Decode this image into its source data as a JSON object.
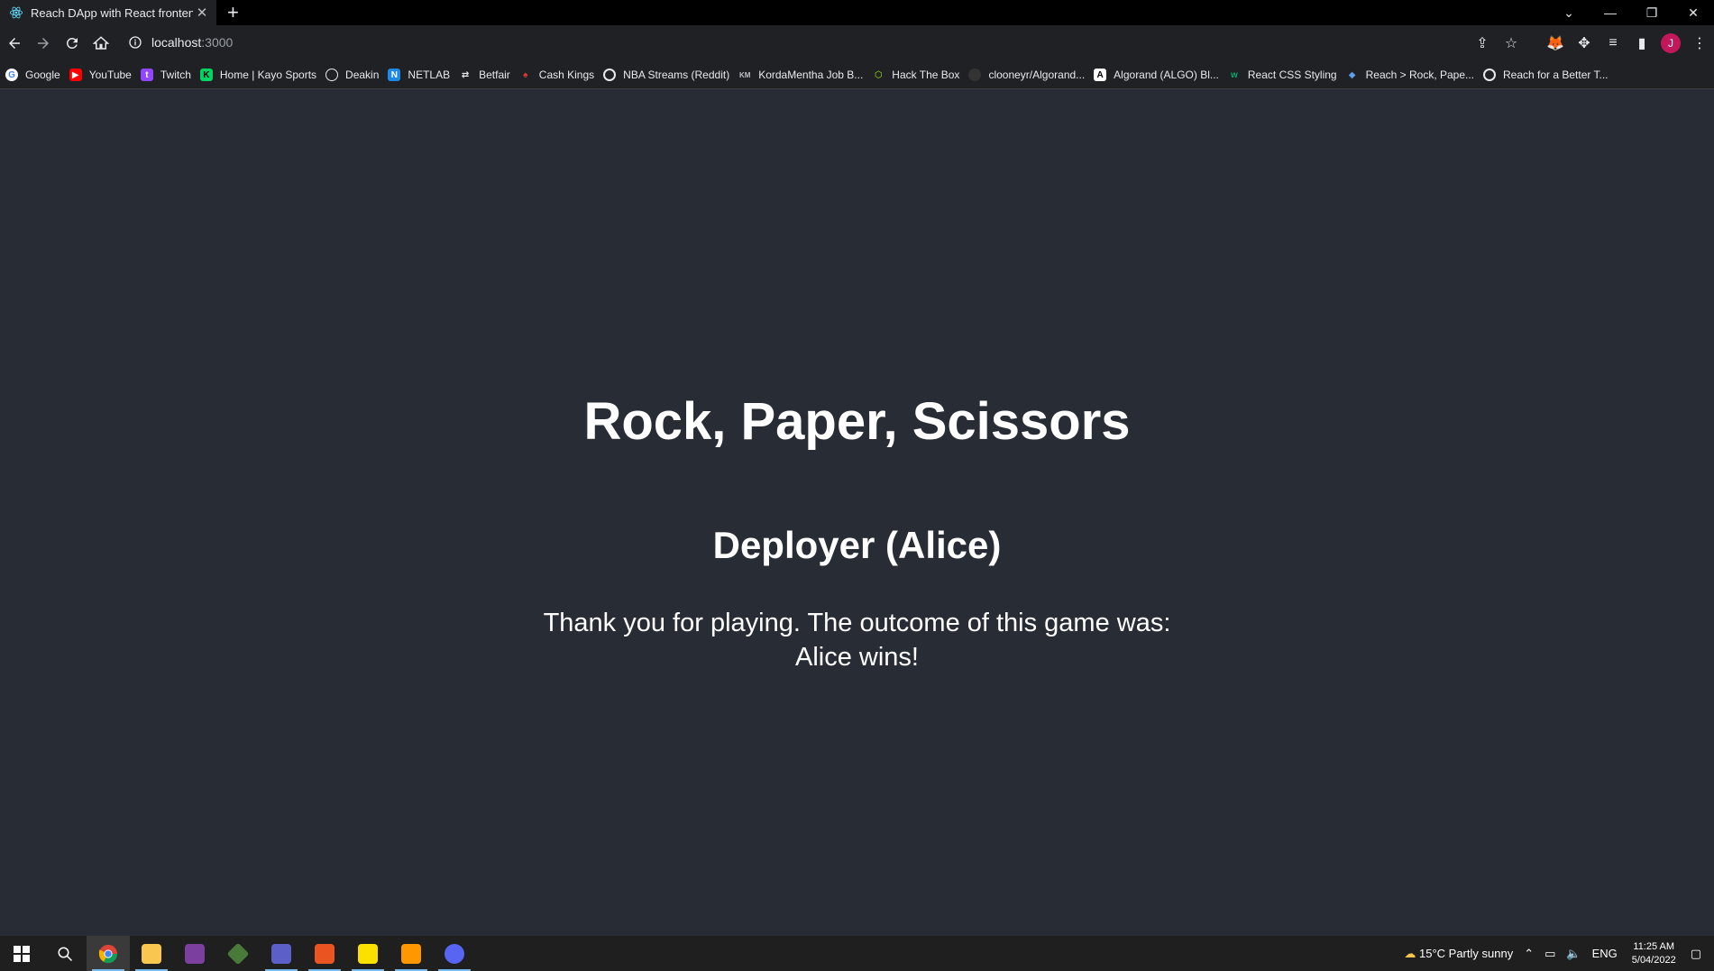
{
  "browser": {
    "tab": {
      "title": "Reach DApp with React frontend"
    },
    "address": {
      "host": "localhost",
      "port": ":3000"
    },
    "bookmarks": [
      {
        "label": "Google",
        "color": "#ffffff"
      },
      {
        "label": "YouTube",
        "color": "#ff0000"
      },
      {
        "label": "Twitch",
        "color": "#9146ff"
      },
      {
        "label": "Home | Kayo Sports",
        "color": "#00d563"
      },
      {
        "label": "Deakin",
        "color": "#e8eaed"
      },
      {
        "label": "NETLAB",
        "color": "#1e88e5"
      },
      {
        "label": "Betfair",
        "color": "#e8eaed"
      },
      {
        "label": "Cash Kings",
        "color": "#e53935"
      },
      {
        "label": "NBA Streams (Reddit)",
        "color": "#e8eaed"
      },
      {
        "label": "KordaMentha Job B...",
        "color": "#5f6368"
      },
      {
        "label": "Hack The Box",
        "color": "#9fef00"
      },
      {
        "label": "clooneyr/Algorand...",
        "color": "#333333"
      },
      {
        "label": "Algorand (ALGO) Bl...",
        "color": "#ffffff"
      },
      {
        "label": "React CSS Styling",
        "color": "#04aa6d"
      },
      {
        "label": "Reach > Rock, Pape...",
        "color": "#5c9ded"
      },
      {
        "label": "Reach for a Better T...",
        "color": "#e8eaed"
      }
    ],
    "avatar_initial": "J"
  },
  "page": {
    "title": "Rock, Paper, Scissors",
    "participant": "Deployer (Alice)",
    "outcome_line1": "Thank you for playing. The outcome of this game was:",
    "outcome_line2": "Alice wins!"
  },
  "taskbar": {
    "weather": "15°C  Partly sunny",
    "language": "ENG",
    "time": "11:25 AM",
    "date": "5/04/2022"
  }
}
